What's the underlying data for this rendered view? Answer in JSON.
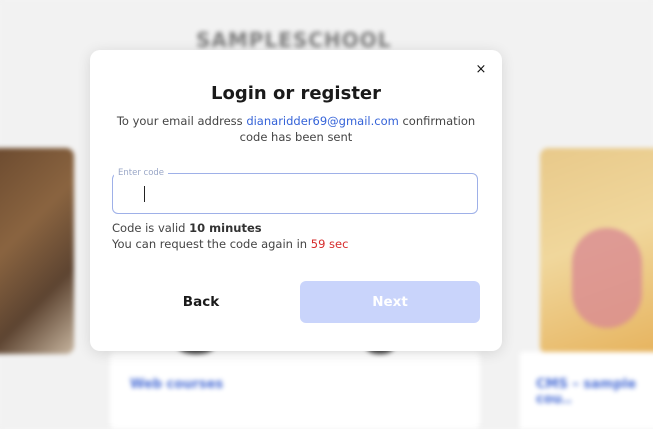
{
  "background": {
    "site_title": "SAMPLESCHOOL",
    "course_link_left": "Web courses",
    "course_meta_left": "",
    "course_link_right": "CMS – sample cou..",
    "course_meta_right": ""
  },
  "modal": {
    "close_icon": "×",
    "title": "Login or register",
    "subtitle_prefix": "To your email address",
    "email": "dianaridder69@gmail.com",
    "subtitle_suffix": "confirmation code has been sent",
    "code_field": {
      "label": "Enter code",
      "value": "",
      "placeholder": ""
    },
    "validity_prefix": "Code is valid",
    "validity_value": "10 minutes",
    "resend_prefix": "You can request the code again in",
    "resend_timer": "59 sec",
    "back_label": "Back",
    "next_label": "Next"
  },
  "colors": {
    "accent": "#3563d8",
    "timer": "#d62b2b",
    "next_disabled": "#c9d4fb"
  }
}
